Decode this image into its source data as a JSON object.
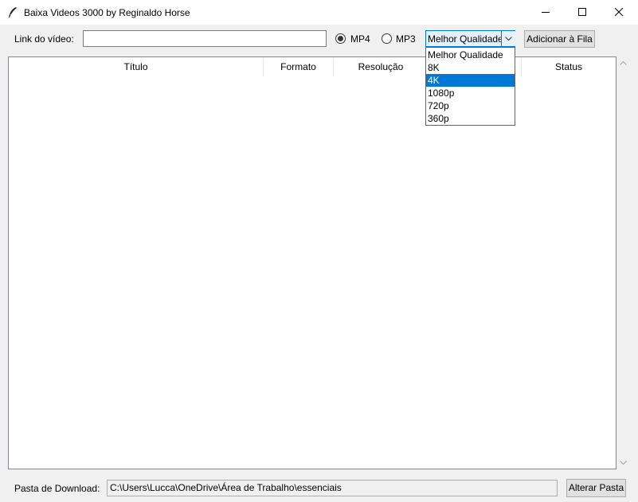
{
  "window": {
    "title": "Baixa Videos 3000 by Reginaldo Horse",
    "minimize": "minimize-icon",
    "maximize": "maximize-icon",
    "close": "close-icon"
  },
  "top_bar": {
    "link_label": "Link do vídeo:",
    "link_value": "",
    "format_options": [
      {
        "label": "MP4",
        "selected": true
      },
      {
        "label": "MP3",
        "selected": false
      }
    ],
    "quality_value": "Melhor Qualidade",
    "add_button": "Adicionar à Fila"
  },
  "quality_dropdown": {
    "options": [
      "Melhor Qualidade",
      "8K",
      "4K",
      "1080p",
      "720p",
      "360p"
    ],
    "highlighted": "4K"
  },
  "queue_table": {
    "columns": [
      "Título",
      "Formato",
      "Resolução",
      "",
      "Status"
    ],
    "rows": []
  },
  "bottom_bar": {
    "folder_label": "Pasta de Download:",
    "folder_path": "C:\\Users\\Lucca\\OneDrive\\Área de Trabalho\\essenciais",
    "change_button": "Alterar Pasta"
  },
  "colors": {
    "accent": "#0078d7",
    "window_bg": "#f0f0f0"
  }
}
